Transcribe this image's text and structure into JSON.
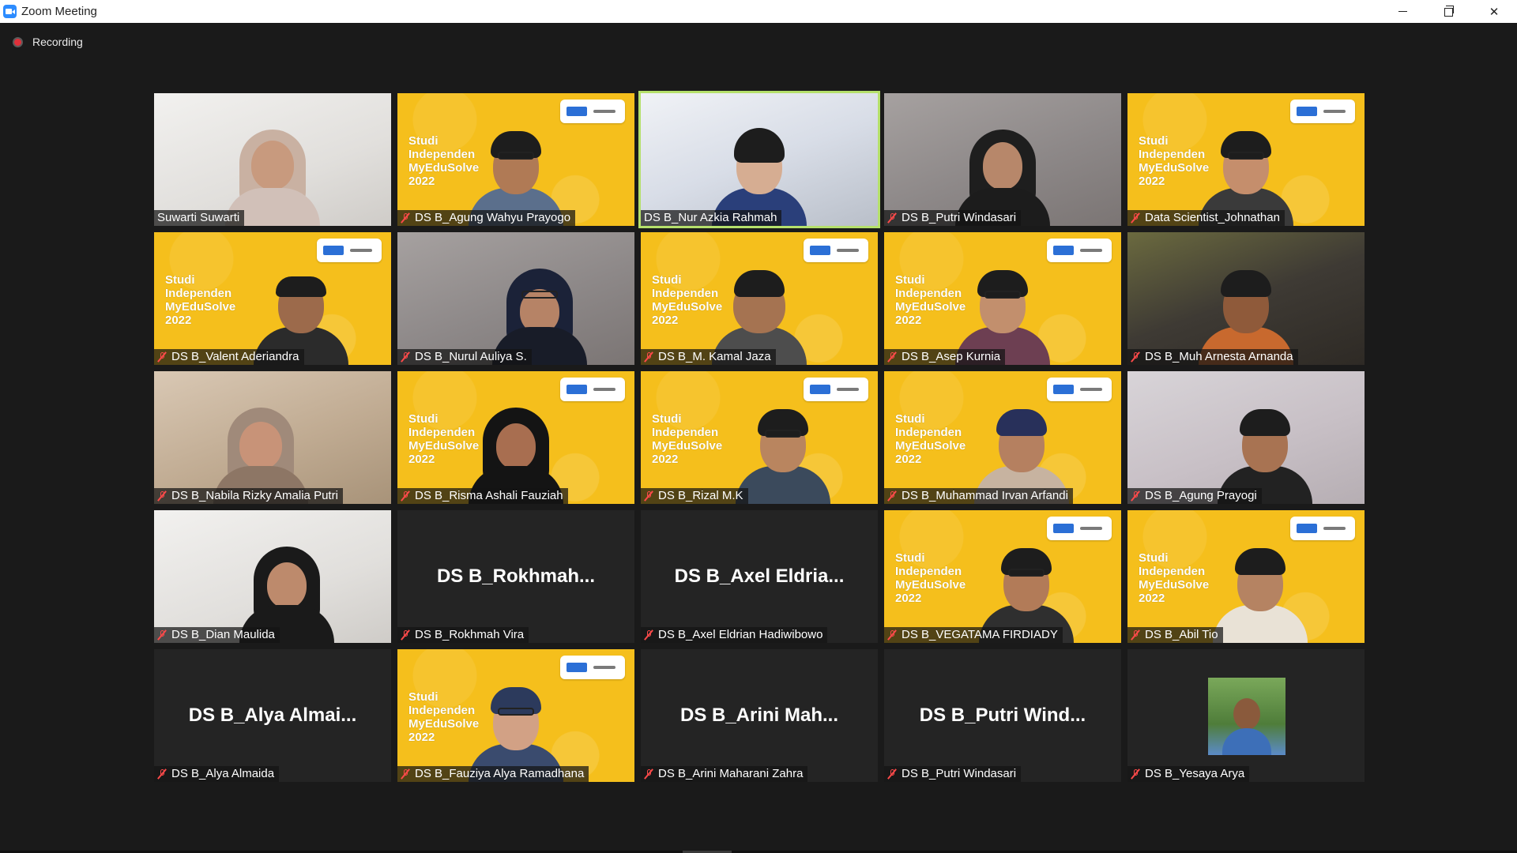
{
  "window": {
    "title": "Zoom Meeting",
    "controls": {
      "minimize_icon": "minimize-icon",
      "restore_icon": "restore-icon",
      "close_glyph": "✕"
    }
  },
  "recording": {
    "label": "Recording",
    "color": "#e0303a"
  },
  "colors": {
    "active_speaker_border": "#b5e06b",
    "banner_yellow": "#f5bf1c",
    "muted_red": "#ff4a4a"
  },
  "banner": {
    "text": "Studi\nIndependen\nMyEduSolve\n2022"
  },
  "participants": [
    {
      "name": "Suwarti Suwarti",
      "muted": false
    },
    {
      "name": "DS B_Agung Wahyu Prayogo",
      "muted": true
    },
    {
      "name": "DS B_Nur Azkia Rahmah",
      "muted": false,
      "active": true
    },
    {
      "name": "DS B_Putri Windasari",
      "muted": true
    },
    {
      "name": "Data Scientist_Johnathan",
      "muted": true
    },
    {
      "name": "DS B_Valent Aderiandra",
      "muted": true
    },
    {
      "name": "DS B_Nurul Auliya S.",
      "muted": true
    },
    {
      "name": "DS B_M. Kamal Jaza",
      "muted": true
    },
    {
      "name": "DS B_Asep Kurnia",
      "muted": true
    },
    {
      "name": "DS B_Muh Arnesta Arnanda",
      "muted": true
    },
    {
      "name": "DS B_Nabila Rizky Amalia Putri",
      "muted": true
    },
    {
      "name": "DS B_Risma Ashali Fauziah",
      "muted": true
    },
    {
      "name": "DS B_Rizal M.K",
      "muted": true
    },
    {
      "name": "DS B_Muhammad Irvan Arfandi",
      "muted": true
    },
    {
      "name": "DS B_Agung Prayogi",
      "muted": true
    },
    {
      "name": "DS B_Dian Maulida",
      "muted": true
    },
    {
      "name": "DS B_Rokhmah Vira",
      "muted": true,
      "display_name": "DS B_Rokhmah..."
    },
    {
      "name": "DS B_Axel Eldrian Hadiwibowo",
      "muted": true,
      "display_name": "DS B_Axel Eldria..."
    },
    {
      "name": "DS B_VEGATAMA FIRDIADY",
      "muted": true
    },
    {
      "name": "DS B_Abil Tio",
      "muted": true
    },
    {
      "name": "DS B_Alya Almaida",
      "muted": true,
      "display_name": "DS B_Alya Almai..."
    },
    {
      "name": "DS B_Fauziya Alya Ramadhana",
      "muted": true
    },
    {
      "name": "DS B_Arini Maharani Zahra",
      "muted": true,
      "display_name": "DS B_Arini Mah..."
    },
    {
      "name": "DS B_Putri Windasari",
      "muted": true,
      "display_name": "DS B_Putri Wind..."
    },
    {
      "name": "DS B_Yesaya Arya",
      "muted": true
    }
  ]
}
